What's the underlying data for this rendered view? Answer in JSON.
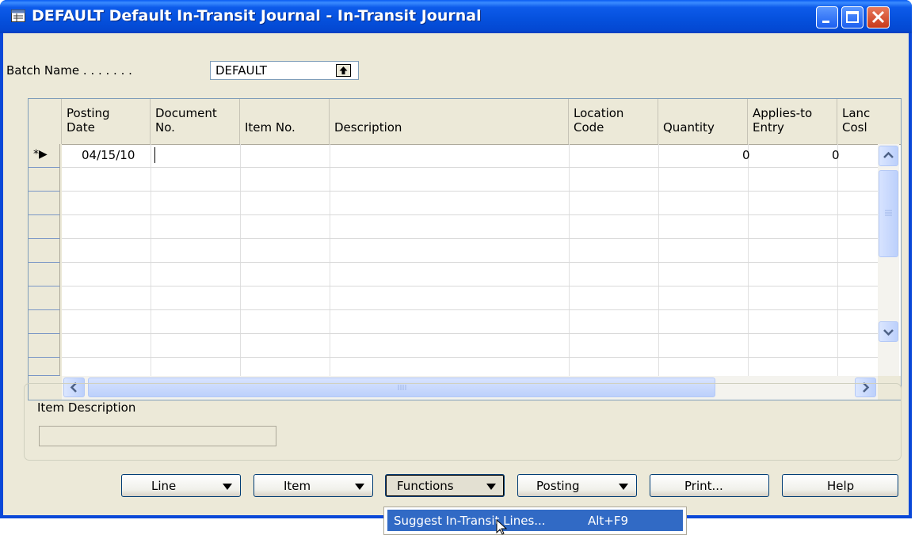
{
  "window": {
    "title": "DEFAULT Default In-Transit Journal - In-Transit Journal",
    "controls": {
      "minimize": "minimize-icon",
      "maximize": "maximize-icon",
      "close": "close-icon"
    }
  },
  "batch": {
    "label": "Batch Name . . . . . . .",
    "value": "DEFAULT"
  },
  "grid": {
    "columns": [
      {
        "line1": "Posting",
        "line2": "Date"
      },
      {
        "line1": "Document",
        "line2": "No."
      },
      {
        "line1": "",
        "line2": "Item No."
      },
      {
        "line1": "",
        "line2": "Description"
      },
      {
        "line1": "Location",
        "line2": "Code"
      },
      {
        "line1": "",
        "line2": "Quantity"
      },
      {
        "line1": "Applies-to",
        "line2": "Entry"
      },
      {
        "line1": "Lanc",
        "line2": "Cosl"
      }
    ],
    "new_row_marker": "*▶",
    "rows": [
      {
        "posting_date": "04/15/10",
        "document_no": "",
        "item_no": "",
        "description": "",
        "location_code": "",
        "quantity": "0",
        "applies_to_entry": "0"
      }
    ]
  },
  "item_description": {
    "label": "Item Description",
    "value": ""
  },
  "buttons": {
    "line": "Line",
    "item": "Item",
    "functions": "Functions",
    "posting": "Posting",
    "print": "Print...",
    "help": "Help"
  },
  "functions_menu": {
    "items": [
      {
        "label": "Suggest In-Transit Lines...",
        "shortcut": "Alt+F9"
      }
    ]
  },
  "colors": {
    "titlebar": "#0550dc",
    "client": "#ece9d8",
    "menu_highlight": "#316ac5"
  }
}
